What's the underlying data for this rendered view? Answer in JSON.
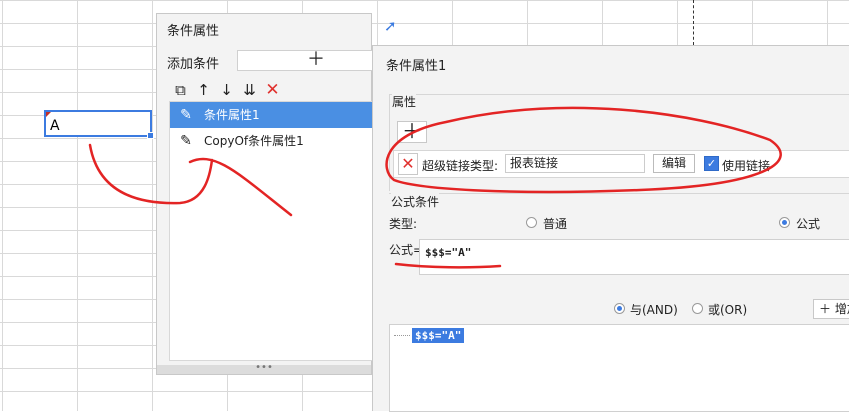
{
  "sheet": {
    "cell_value": "A"
  },
  "left_dialog": {
    "title": "条件属性",
    "add_condition_label": "添加条件",
    "add_button_glyph": "＋",
    "toolbar": [
      {
        "name": "copy-icon",
        "glyph": "⧉"
      },
      {
        "name": "arrow-up-icon",
        "glyph": "↑"
      },
      {
        "name": "arrow-down-icon",
        "glyph": "↓"
      },
      {
        "name": "move-bottom-icon",
        "glyph": "⇊"
      },
      {
        "name": "delete-icon",
        "glyph": "✕"
      }
    ],
    "items": [
      {
        "label": "条件属性1",
        "icon": "✎",
        "selected": true
      },
      {
        "label": "CopyOf条件属性1",
        "icon": "✎",
        "selected": false
      }
    ],
    "resize_glyph": "•••"
  },
  "right_dialog": {
    "title": "条件属性1",
    "property_section": "属性",
    "add_property_glyph": "＋",
    "hyperlink_type_label": "超级链接类型:",
    "hyperlink_type_value": "报表链接",
    "edit_button": "编辑",
    "use_link_label": "使用链接",
    "use_link_checked": true,
    "formula_section": "公式条件",
    "type_label": "类型:",
    "type_options": [
      {
        "label": "普通",
        "selected": false
      },
      {
        "label": "公式",
        "selected": true
      }
    ],
    "formula_label": "公式=",
    "formula_value": "$$$=\"A\"",
    "logic_options": [
      {
        "label": "与(AND)",
        "selected": true
      },
      {
        "label": "或(OR)",
        "selected": false
      }
    ],
    "add_button_label": "＋ 增加",
    "tree_node": "$$$=\"A\""
  },
  "colors": {
    "accent": "#3c7be0",
    "selection": "#4a8fe3",
    "delete_red": "#e0312e",
    "annotation_red": "#e32424"
  }
}
